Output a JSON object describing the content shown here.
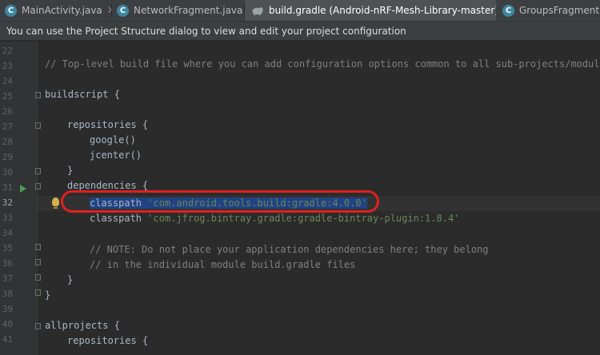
{
  "tabs": [
    {
      "label": "MainActivity.java",
      "icon": "java-class-icon",
      "active": false
    },
    {
      "label": "NetworkFragment.java",
      "icon": "java-class-icon",
      "active": false
    },
    {
      "label": "build.gradle (Android-nRF-Mesh-Library-master)",
      "icon": "gradle-elephant-icon",
      "active": true
    },
    {
      "label": "GroupsFragment.java",
      "icon": "java-class-icon",
      "active": false
    }
  ],
  "banner": {
    "text": "You can use the Project Structure dialog to view and edit your project configuration"
  },
  "editor": {
    "line_numbers": [
      "22",
      "23",
      "24",
      "25",
      "26",
      "27",
      "28",
      "29",
      "30",
      "31",
      "32",
      "33",
      "34",
      "35",
      "36",
      "37",
      "38",
      "39",
      "40",
      "41"
    ],
    "current_line": "32",
    "code": {
      "l23": "// Top-level build file where you can add configuration options common to all sub-projects/modules.",
      "l25": "buildscript {",
      "l27": "repositories {",
      "l28": "google()",
      "l29": "jcenter()",
      "l30": "}",
      "l31": "dependencies {",
      "l32_keyword": "classpath",
      "l32_string": "'com.android.tools.build:gradle:4.0.0'",
      "l33_keyword": "classpath",
      "l33_string": "'com.jfrog.bintray.gradle:gradle-bintray-plugin:1.8.4'",
      "l35": "// NOTE: Do not place your application dependencies here; they belong",
      "l36": "// in the individual module build.gradle files",
      "l37": "}",
      "l38": "}",
      "l40": "allprojects {",
      "l41": "repositories {"
    }
  },
  "colors": {
    "background": "#2b2b2b",
    "comment": "#808080",
    "string": "#6a8759",
    "text": "#a9b7c6",
    "selection": "#214283",
    "annotation_circle": "#e02020"
  }
}
